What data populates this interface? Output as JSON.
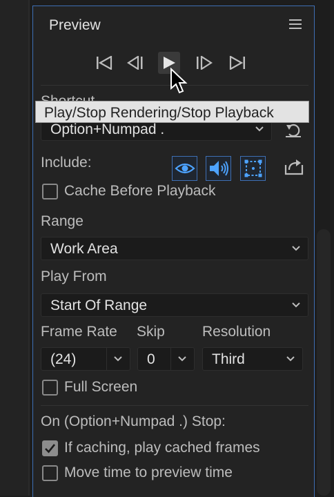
{
  "panel": {
    "title": "Preview"
  },
  "tooltip": {
    "text": "Play/Stop Rendering/Stop Playback"
  },
  "shortcut": {
    "label": "Shortcut",
    "value": "Option+Numpad ."
  },
  "include": {
    "label": "Include:",
    "buttons": [
      "eye-icon",
      "speaker-icon",
      "overlay-frame-icon"
    ]
  },
  "cache_before_playback": {
    "label": "Cache Before Playback",
    "checked": false
  },
  "range": {
    "label": "Range",
    "value": "Work Area"
  },
  "play_from": {
    "label": "Play From",
    "value": "Start Of Range"
  },
  "frame_rate": {
    "label": "Frame Rate",
    "value": "(24)"
  },
  "skip": {
    "label": "Skip",
    "value": "0"
  },
  "resolution": {
    "label": "Resolution",
    "value": "Third"
  },
  "full_screen": {
    "label": "Full Screen",
    "checked": false
  },
  "stop": {
    "heading": "On (Option+Numpad .) Stop:",
    "if_caching": {
      "label": "If caching, play cached frames",
      "checked": true
    },
    "move_time": {
      "label": "Move time to preview time",
      "checked": false
    }
  },
  "colors": {
    "accent": "#3e6fb5",
    "icon_blue": "#4da3ff",
    "panel_bg": "#232323"
  }
}
